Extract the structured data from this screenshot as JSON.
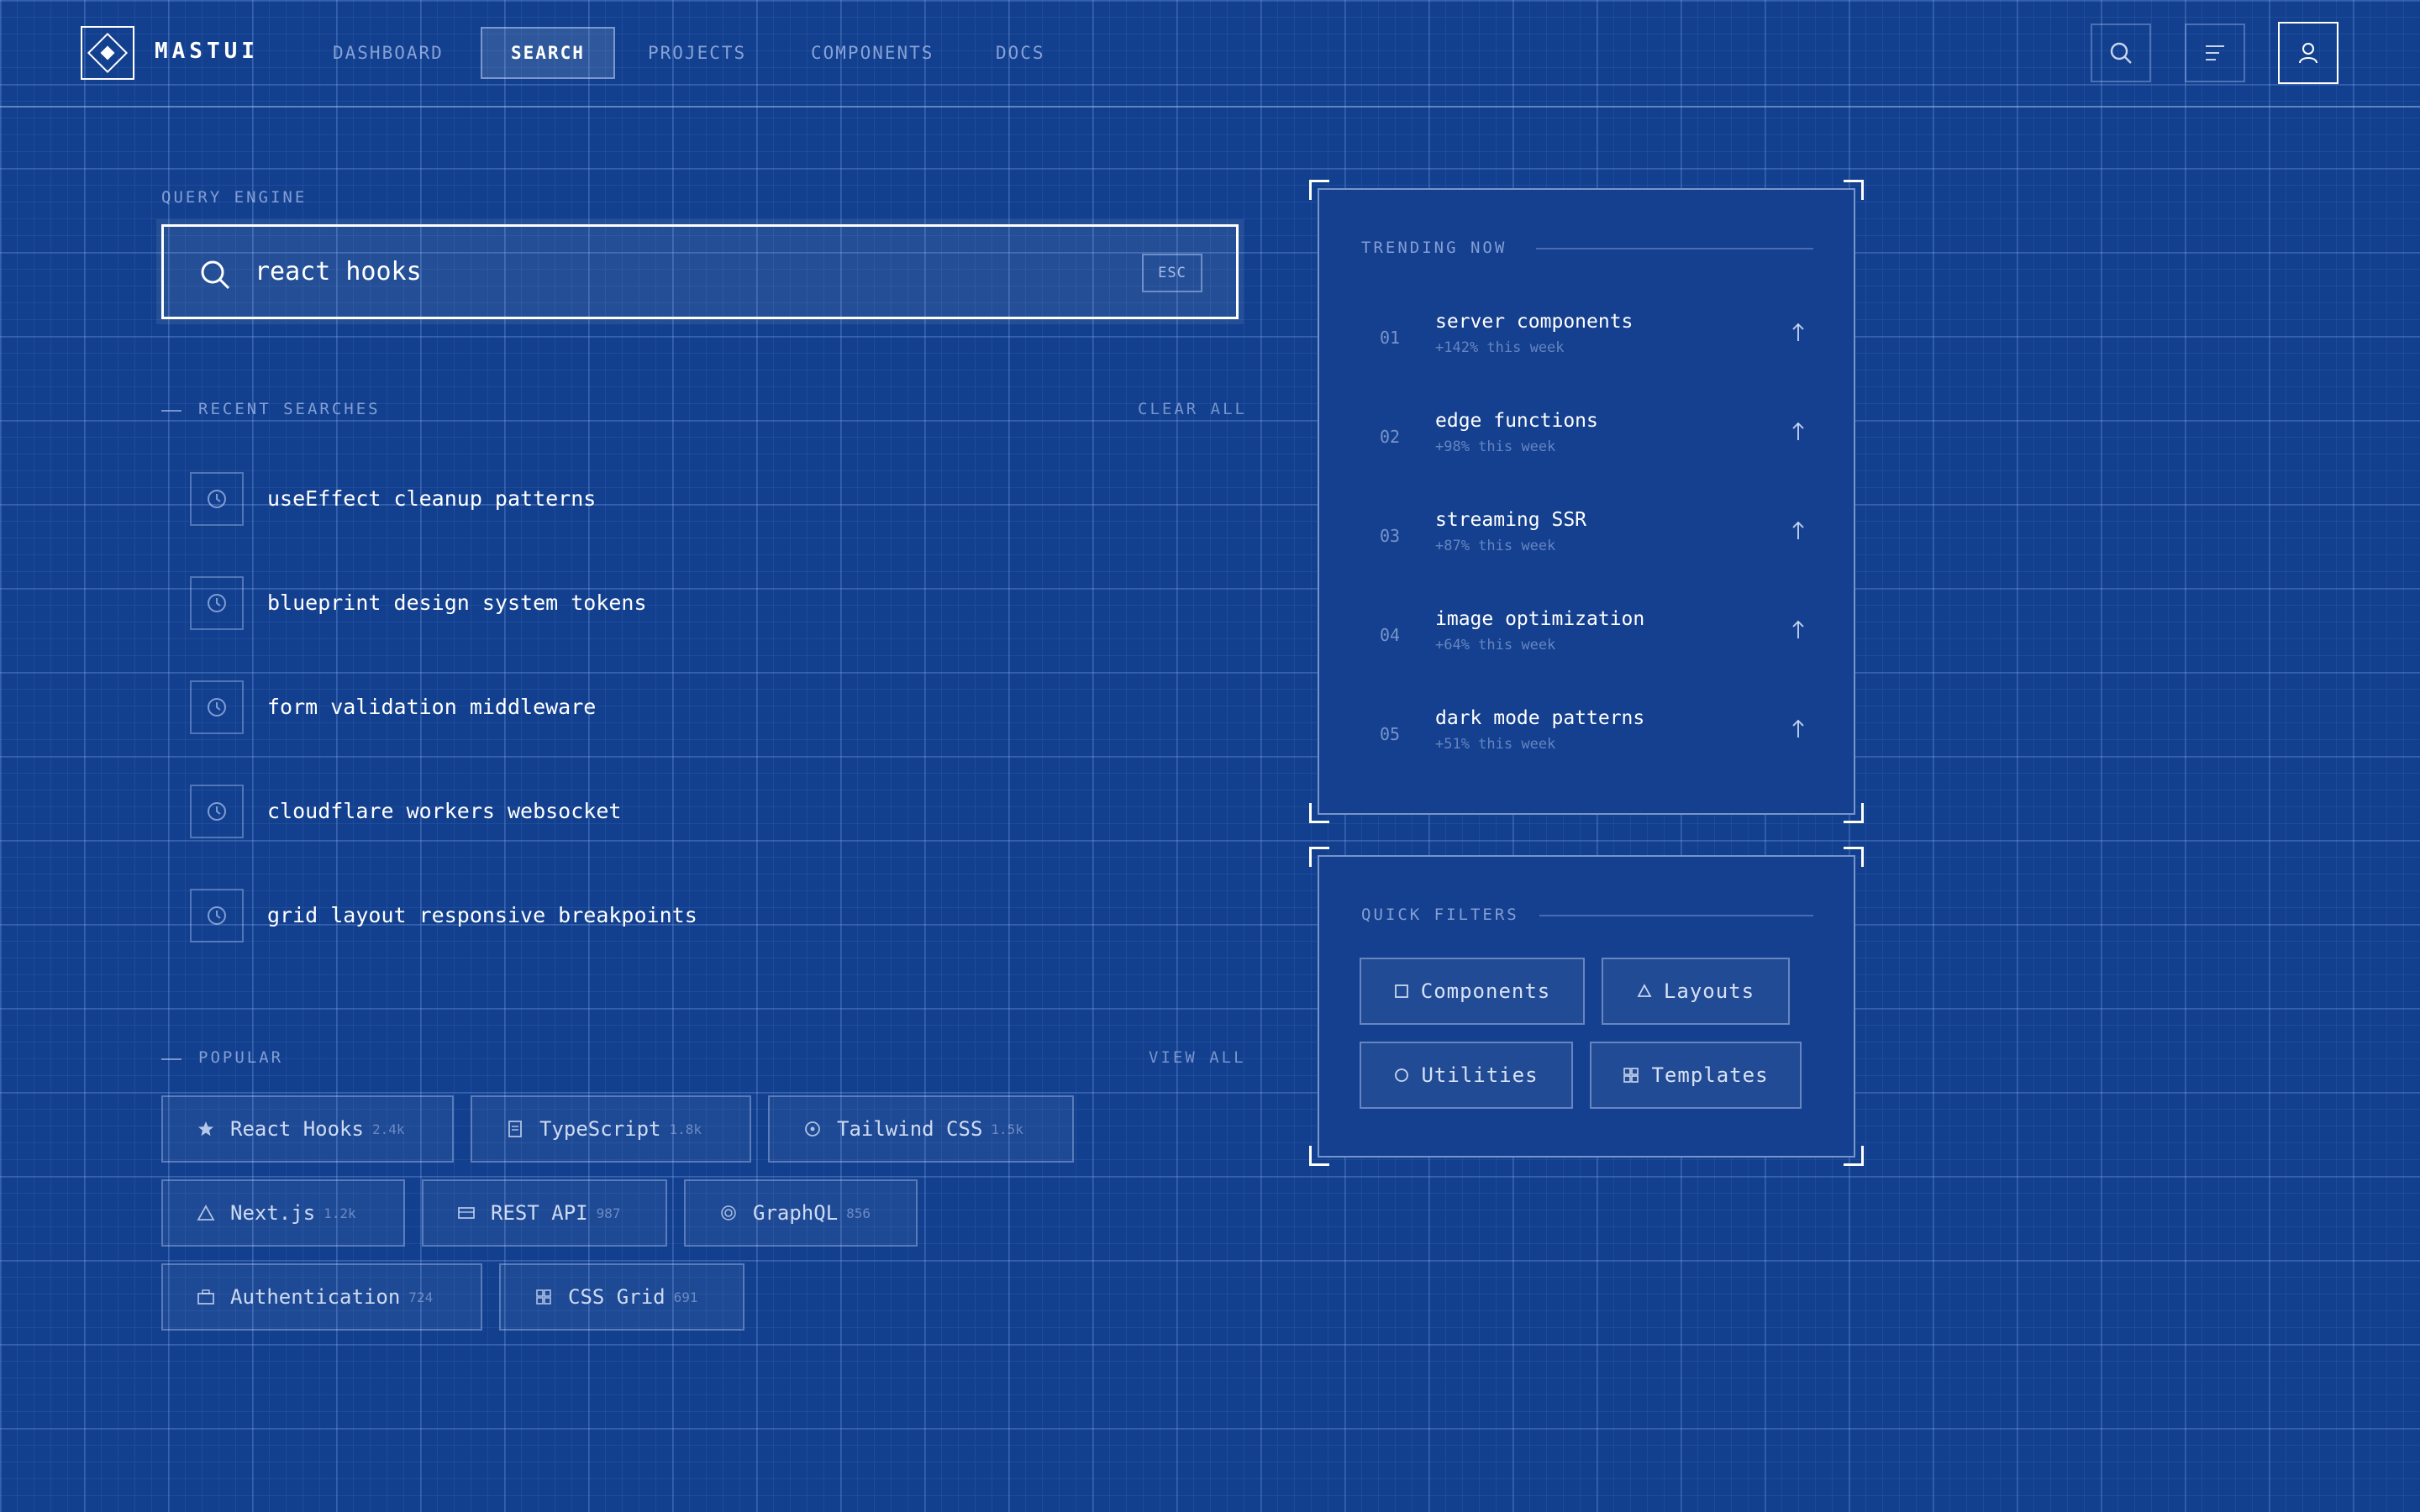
{
  "app": {
    "name": "MASTUI"
  },
  "nav": {
    "items": [
      {
        "label": "DASHBOARD"
      },
      {
        "label": "SEARCH",
        "active": true
      },
      {
        "label": "PROJECTS"
      },
      {
        "label": "COMPONENTS"
      },
      {
        "label": "DOCS"
      }
    ]
  },
  "header_actions": {
    "icons": [
      "search-icon",
      "menu-icon",
      "user-icon"
    ]
  },
  "search": {
    "label": "QUERY ENGINE",
    "value": "react hooks",
    "esc_label": "ESC"
  },
  "recent": {
    "title": "RECENT SEARCHES",
    "clear_label": "CLEAR ALL",
    "items": [
      {
        "text": "useEffect cleanup patterns"
      },
      {
        "text": "blueprint design system tokens"
      },
      {
        "text": "form validation middleware"
      },
      {
        "text": "cloudflare workers websocket"
      },
      {
        "text": "grid layout responsive breakpoints"
      }
    ]
  },
  "popular": {
    "title": "POPULAR",
    "view_all_label": "VIEW ALL",
    "tags": [
      {
        "label": "React Hooks",
        "count": "2.4k",
        "icon": "star-icon"
      },
      {
        "label": "TypeScript",
        "count": "1.8k",
        "icon": "document-icon"
      },
      {
        "label": "Tailwind CSS",
        "count": "1.5k",
        "icon": "target-icon"
      },
      {
        "label": "Next.js",
        "count": "1.2k",
        "icon": "triangle-icon"
      },
      {
        "label": "REST API",
        "count": "987",
        "icon": "card-icon"
      },
      {
        "label": "GraphQL",
        "count": "856",
        "icon": "radio-icon"
      },
      {
        "label": "Authentication",
        "count": "724",
        "icon": "briefcase-icon"
      },
      {
        "label": "CSS Grid",
        "count": "691",
        "icon": "grid-icon"
      }
    ]
  },
  "trending": {
    "title": "TRENDING NOW",
    "items": [
      {
        "num": "01",
        "title": "server components",
        "sub": "+142% this week"
      },
      {
        "num": "02",
        "title": "edge functions",
        "sub": "+98% this week"
      },
      {
        "num": "03",
        "title": "streaming SSR",
        "sub": "+87% this week"
      },
      {
        "num": "04",
        "title": "image optimization",
        "sub": "+64% this week"
      },
      {
        "num": "05",
        "title": "dark mode patterns",
        "sub": "+51% this week"
      }
    ]
  },
  "quick_filters": {
    "title": "QUICK FILTERS",
    "items": [
      {
        "label": "Components",
        "icon": "square-icon"
      },
      {
        "label": "Layouts",
        "icon": "triangle-icon"
      },
      {
        "label": "Utilities",
        "icon": "circle-icon"
      },
      {
        "label": "Templates",
        "icon": "grid-icon"
      }
    ]
  },
  "colors": {
    "background": "#12408f",
    "panel": "#14408f",
    "text": "#ffffff"
  }
}
